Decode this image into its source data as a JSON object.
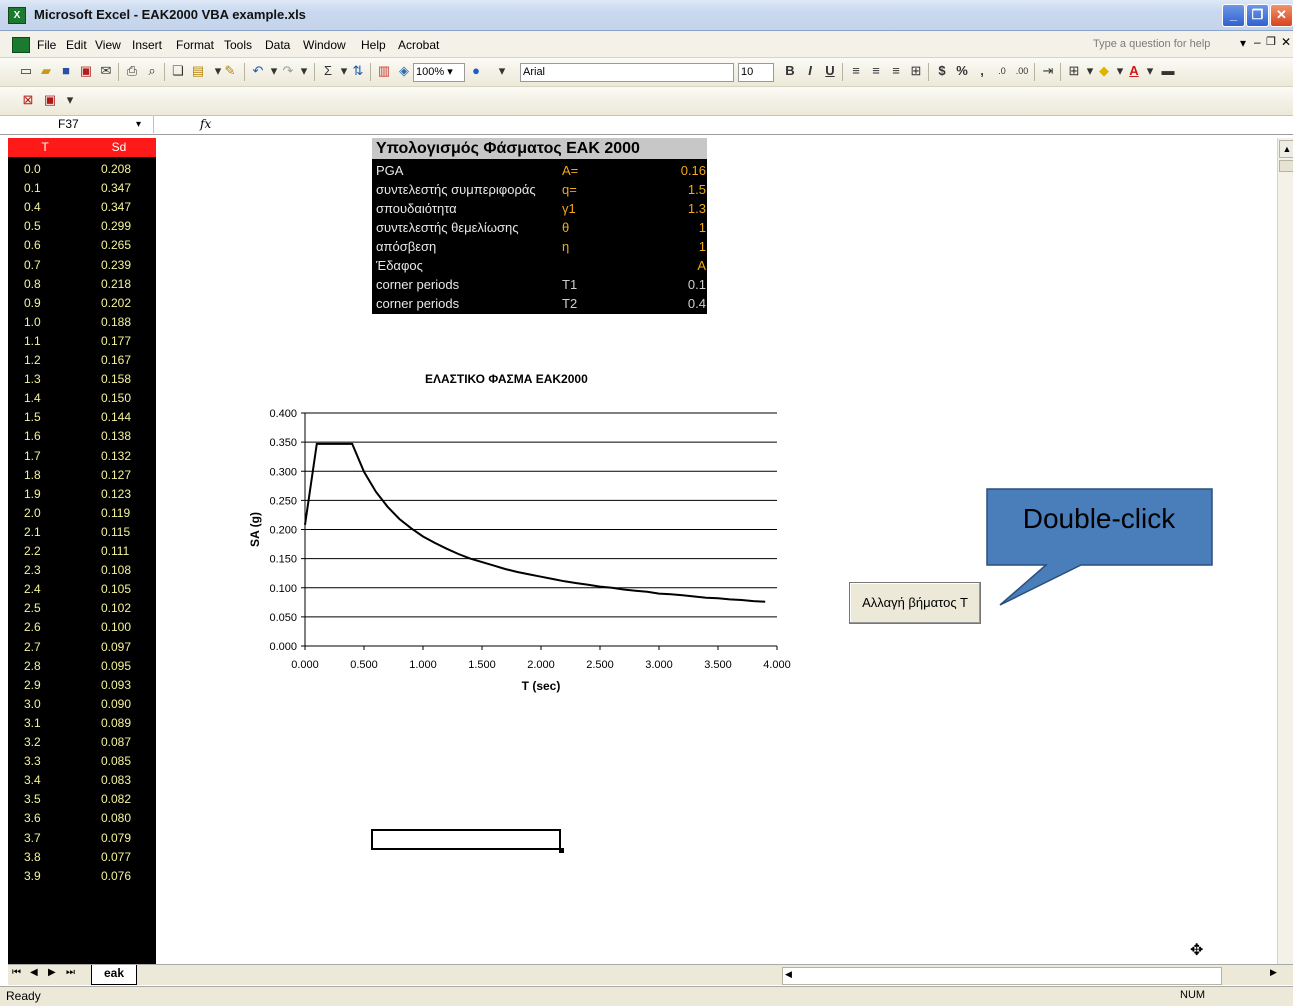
{
  "window": {
    "title": "Microsoft Excel - EAK2000 VBA example.xls",
    "app_icon": "excel-icon"
  },
  "menu": {
    "items": [
      "File",
      "Edit",
      "View",
      "Insert",
      "Format",
      "Tools",
      "Data",
      "Window",
      "Help",
      "Acrobat"
    ],
    "question_box": "Type a question for help"
  },
  "toolbar": {
    "zoom": "100%",
    "font": "Arial",
    "font_size": "10"
  },
  "formula_bar": {
    "cell_ref": "F37",
    "fx": "fx"
  },
  "spectrum_table": {
    "header_T": "T",
    "header_Sd": "Sd",
    "rows": [
      [
        "0.0",
        "0.208"
      ],
      [
        "0.1",
        "0.347"
      ],
      [
        "0.4",
        "0.347"
      ],
      [
        "0.5",
        "0.299"
      ],
      [
        "0.6",
        "0.265"
      ],
      [
        "0.7",
        "0.239"
      ],
      [
        "0.8",
        "0.218"
      ],
      [
        "0.9",
        "0.202"
      ],
      [
        "1.0",
        "0.188"
      ],
      [
        "1.1",
        "0.177"
      ],
      [
        "1.2",
        "0.167"
      ],
      [
        "1.3",
        "0.158"
      ],
      [
        "1.4",
        "0.150"
      ],
      [
        "1.5",
        "0.144"
      ],
      [
        "1.6",
        "0.138"
      ],
      [
        "1.7",
        "0.132"
      ],
      [
        "1.8",
        "0.127"
      ],
      [
        "1.9",
        "0.123"
      ],
      [
        "2.0",
        "0.119"
      ],
      [
        "2.1",
        "0.115"
      ],
      [
        "2.2",
        "0.111"
      ],
      [
        "2.3",
        "0.108"
      ],
      [
        "2.4",
        "0.105"
      ],
      [
        "2.5",
        "0.102"
      ],
      [
        "2.6",
        "0.100"
      ],
      [
        "2.7",
        "0.097"
      ],
      [
        "2.8",
        "0.095"
      ],
      [
        "2.9",
        "0.093"
      ],
      [
        "3.0",
        "0.090"
      ],
      [
        "3.1",
        "0.089"
      ],
      [
        "3.2",
        "0.087"
      ],
      [
        "3.3",
        "0.085"
      ],
      [
        "3.4",
        "0.083"
      ],
      [
        "3.5",
        "0.082"
      ],
      [
        "3.6",
        "0.080"
      ],
      [
        "3.7",
        "0.079"
      ],
      [
        "3.8",
        "0.077"
      ],
      [
        "3.9",
        "0.076"
      ]
    ]
  },
  "params": {
    "title": "Υπολογισμός Φάσματος ΕΑΚ 2000",
    "rows": [
      {
        "name": "PGA",
        "symbol": "A=",
        "value": "0.16",
        "accent": true
      },
      {
        "name": "συντελεστής συμπεριφοράς",
        "symbol": "q=",
        "value": "1.5",
        "accent": true
      },
      {
        "name": "σπουδαιότητα",
        "symbol": "γ1",
        "value": "1.3",
        "accent": true
      },
      {
        "name": "συντελεστής θεμελίωσης",
        "symbol": "θ",
        "value": "1",
        "accent": true
      },
      {
        "name": "απόσβεση",
        "symbol": "η",
        "value": "1",
        "accent": true
      },
      {
        "name": "Έδαφος",
        "symbol": "",
        "value": "A",
        "accent": true
      },
      {
        "name": "corner periods",
        "symbol": "T1",
        "value": "0.1",
        "accent": false
      },
      {
        "name": "corner periods",
        "symbol": "T2",
        "value": "0.4",
        "accent": false
      }
    ]
  },
  "chart_data": {
    "type": "line",
    "title": "ΕΛΑΣΤΙΚΟ ΦΑΣΜΑ ΕΑΚ2000",
    "xlabel": "T (sec)",
    "ylabel": "SA (g)",
    "xlim": [
      0,
      4.0
    ],
    "ylim": [
      0,
      0.4
    ],
    "xticks": [
      "0.000",
      "0.500",
      "1.000",
      "1.500",
      "2.000",
      "2.500",
      "3.000",
      "3.500",
      "4.000"
    ],
    "yticks": [
      "0.000",
      "0.050",
      "0.100",
      "0.150",
      "0.200",
      "0.250",
      "0.300",
      "0.350",
      "0.400"
    ],
    "grid": "horizontal",
    "x": [
      0.0,
      0.1,
      0.4,
      0.5,
      0.6,
      0.7,
      0.8,
      0.9,
      1.0,
      1.1,
      1.2,
      1.3,
      1.4,
      1.5,
      1.6,
      1.7,
      1.8,
      1.9,
      2.0,
      2.1,
      2.2,
      2.3,
      2.4,
      2.5,
      2.6,
      2.7,
      2.8,
      2.9,
      3.0,
      3.1,
      3.2,
      3.3,
      3.4,
      3.5,
      3.6,
      3.7,
      3.8,
      3.9
    ],
    "y": [
      0.208,
      0.347,
      0.347,
      0.299,
      0.265,
      0.239,
      0.218,
      0.202,
      0.188,
      0.177,
      0.167,
      0.158,
      0.15,
      0.144,
      0.138,
      0.132,
      0.127,
      0.123,
      0.119,
      0.115,
      0.111,
      0.108,
      0.105,
      0.102,
      0.1,
      0.097,
      0.095,
      0.093,
      0.09,
      0.089,
      0.087,
      0.085,
      0.083,
      0.082,
      0.08,
      0.079,
      0.077,
      0.076
    ]
  },
  "button": {
    "label": "Αλλαγή βήματος Τ"
  },
  "callout": {
    "text": "Double-click",
    "color": "#4a7ebb"
  },
  "sheet": {
    "tab": "eak"
  },
  "status": {
    "left": "Ready",
    "right": "NUM"
  }
}
